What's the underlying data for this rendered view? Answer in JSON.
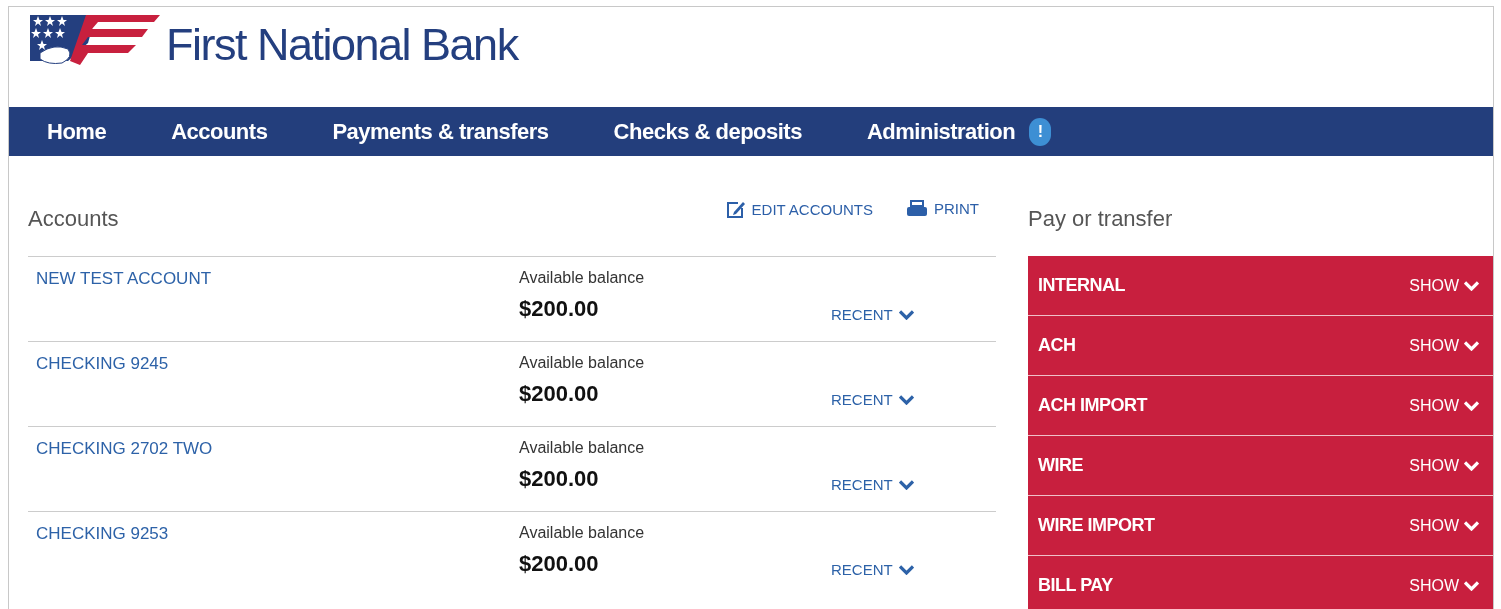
{
  "brand": {
    "name": "First National Bank"
  },
  "nav": [
    {
      "label": "Home"
    },
    {
      "label": "Accounts"
    },
    {
      "label": "Payments & transfers"
    },
    {
      "label": "Checks & deposits"
    },
    {
      "label": "Administration",
      "alert": "!"
    }
  ],
  "accounts": {
    "title": "Accounts",
    "actions": [
      {
        "kind": "edit",
        "label": "EDIT ACCOUNTS"
      },
      {
        "kind": "print",
        "label": "PRINT"
      }
    ],
    "rows": [
      {
        "name": "NEW TEST ACCOUNT",
        "balance_label": "Available balance",
        "balance": "$200.00",
        "recent": "RECENT"
      },
      {
        "name": "CHECKING 9245",
        "balance_label": "Available balance",
        "balance": "$200.00",
        "recent": "RECENT"
      },
      {
        "name": "CHECKING 2702 TWO",
        "balance_label": "Available balance",
        "balance": "$200.00",
        "recent": "RECENT"
      },
      {
        "name": "CHECKING 9253",
        "balance_label": "Available balance",
        "balance": "$200.00",
        "recent": "RECENT"
      }
    ]
  },
  "pay_or_transfer": {
    "title": "Pay or transfer",
    "items": [
      {
        "label": "INTERNAL",
        "toggle": "SHOW",
        "expanded": false
      },
      {
        "label": "ACH",
        "toggle": "SHOW",
        "expanded": false
      },
      {
        "label": "ACH IMPORT",
        "toggle": "SHOW",
        "expanded": false
      },
      {
        "label": "WIRE",
        "toggle": "SHOW",
        "expanded": false
      },
      {
        "label": "WIRE IMPORT",
        "toggle": "SHOW",
        "expanded": false
      },
      {
        "label": "BILL PAY",
        "toggle": "SHOW",
        "expanded": false
      }
    ]
  }
}
